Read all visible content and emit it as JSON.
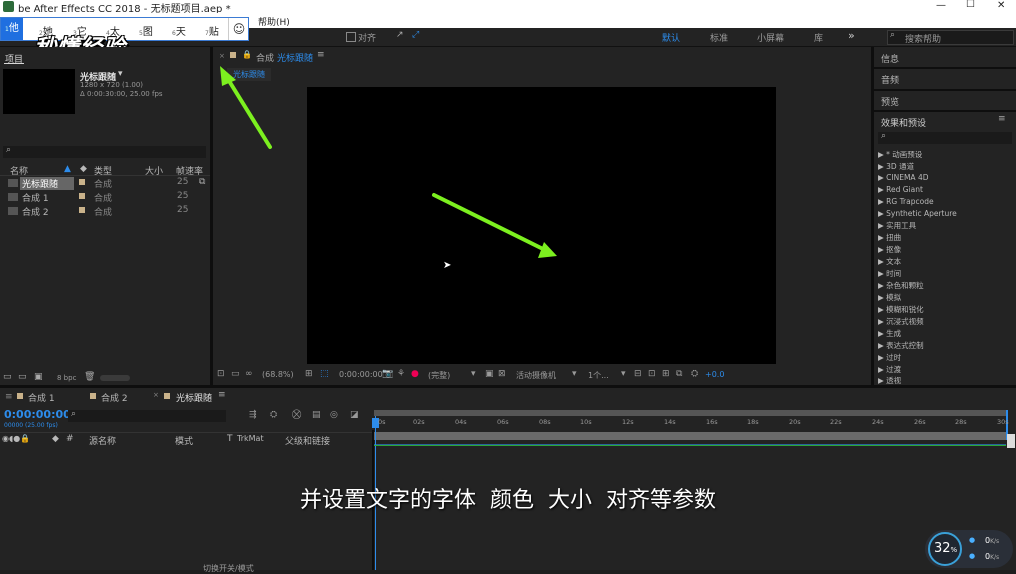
{
  "window": {
    "title": "be After Effects CC 2018 - 无标题项目.aep *",
    "controls": [
      "—",
      "☐",
      "✕"
    ]
  },
  "menu": {
    "help": "帮助(H)"
  },
  "ime": {
    "candidates": [
      {
        "n": "1",
        "t": "他"
      },
      {
        "n": "2",
        "t": "她"
      },
      {
        "n": "3",
        "t": "它"
      },
      {
        "n": "4",
        "t": "太"
      },
      {
        "n": "5",
        "t": "图"
      },
      {
        "n": "6",
        "t": "天"
      },
      {
        "n": "7",
        "t": "贴"
      }
    ],
    "emoji": "☺"
  },
  "watermark": "秒懂经验",
  "toolbar": {
    "snap": "对齐",
    "workspaces": [
      "默认",
      "标准",
      "小屏幕",
      "库"
    ],
    "more": "»",
    "search_placeholder": "搜索帮助"
  },
  "project": {
    "tab": "项目",
    "comp_name": "光标跟随",
    "comp_info1": "1280 x 720 (1.00)",
    "comp_info2": "Δ 0:00:30:00, 25.00 fps",
    "columns": [
      "名称",
      "类型",
      "大小",
      "帧速率"
    ],
    "items": [
      {
        "name": "光标跟随",
        "type": "合成",
        "fps": "25"
      },
      {
        "name": "合成 1",
        "type": "合成",
        "fps": "25"
      },
      {
        "name": "合成 2",
        "type": "合成",
        "fps": "25"
      }
    ],
    "bpc": "8 bpc"
  },
  "composition": {
    "tab_label": "合成",
    "tab_name": "光标跟随",
    "subtab": "光标跟随",
    "zoom": "(68.8%)",
    "timecode": "0:00:00:00",
    "quality": "(完整)",
    "camera": "活动摄像机",
    "views": "1个...",
    "exposure": "+0.0"
  },
  "right_panel": {
    "tabs": [
      "信息",
      "音频",
      "预览"
    ],
    "effects_title": "效果和预设",
    "effects": [
      "* 动画预设",
      "3D 通道",
      "CINEMA 4D",
      "Red Giant",
      "RG Trapcode",
      "Synthetic Aperture",
      "实用工具",
      "扭曲",
      "抠像",
      "文本",
      "时间",
      "杂色和颗粒",
      "模拟",
      "模糊和锐化",
      "沉浸式视频",
      "生成",
      "表达式控制",
      "过时",
      "过渡",
      "透视"
    ]
  },
  "timeline": {
    "tabs": [
      "合成 1",
      "合成 2",
      "光标跟随"
    ],
    "timecode": "0:00:00:00",
    "frames": "00000 (25.00 fps)",
    "columns": [
      "源名称",
      "模式",
      "T",
      "TrkMat",
      "父级和链接"
    ],
    "ticks": [
      "0s",
      "02s",
      "04s",
      "06s",
      "08s",
      "10s",
      "12s",
      "14s",
      "16s",
      "18s",
      "20s",
      "22s",
      "24s",
      "26s",
      "28s",
      "30s"
    ],
    "toggle": "切换开关/模式"
  },
  "subtitle": "并设置文字的字体  颜色  大小  对齐等参数",
  "net_widget": {
    "percent": "32",
    "unit": "%",
    "up": "0",
    "down": "0",
    "rate_unit": "K/s"
  }
}
